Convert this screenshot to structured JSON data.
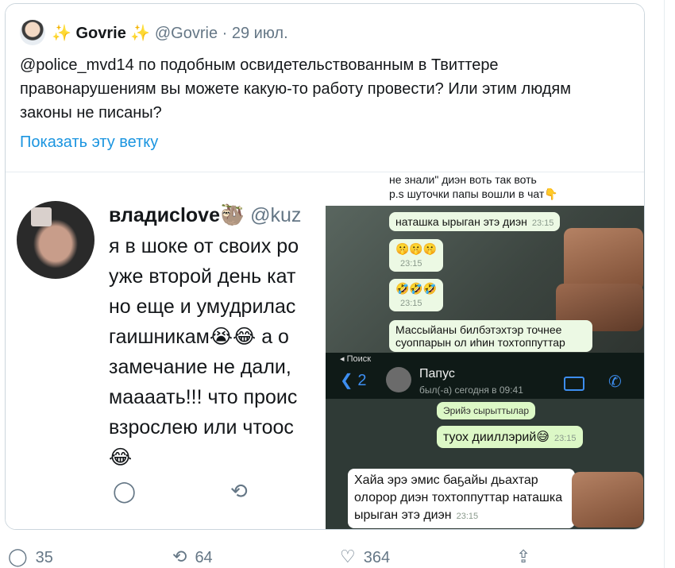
{
  "tweet": {
    "name": "Govrie",
    "sparkle": "✨",
    "handle": "@Govrie",
    "separator": "·",
    "date": "29 июл.",
    "text": "@police_mvd14 по подобным освидетельствованным в Твиттере правонарушениям вы можете какую-то работу провести? Или этим людям законы не писаны?",
    "thread_link": "Показать эту ветку"
  },
  "embedded_tweet": {
    "name": "владиclove",
    "name_emoji": "🦥",
    "handle": "@kuz",
    "text_lines": [
      "я в шоке от своих ро",
      "уже второй день кат",
      "но еще и умудрилас",
      "гаишникам😭😂 а о",
      "замечание не дали,",
      "маааать!!! что проис",
      "взрослею или чтоос",
      "😂"
    ]
  },
  "chat1": {
    "note_line1": "не знали\" диэн воть так воть",
    "note_line2": "p.s шуточки папы вошли в чат👇",
    "msg1": "наташка ырыган этэ диэн",
    "msg1_time": "23:15",
    "msg2": "🤫🤫🤫",
    "msg2_time": "23:15",
    "msg3": "🤣🤣🤣",
    "msg3_time": "23:15",
    "msg4": "Массыйаны билбэтэхтэр точнее суоппарын ол иһин тохтоппуттар"
  },
  "chat2": {
    "search_back": "◂ Поиск",
    "back_count": "2",
    "contact_name": "Папус",
    "last_seen": "был(-а) сегодня в 09:41",
    "msg_prev": "Эрийэ сырыттылар",
    "msg_out": "туох дииллэрий😅",
    "msg_out_time": "23:15",
    "msg_in": "Хайа эрэ эмис баҕайы дьахтар олорор диэн тохтоппуттар наташка ырыган этэ диэн",
    "msg_in_time": "23:15"
  },
  "stats": {
    "replies": "35",
    "retweets": "64",
    "likes": "364"
  }
}
